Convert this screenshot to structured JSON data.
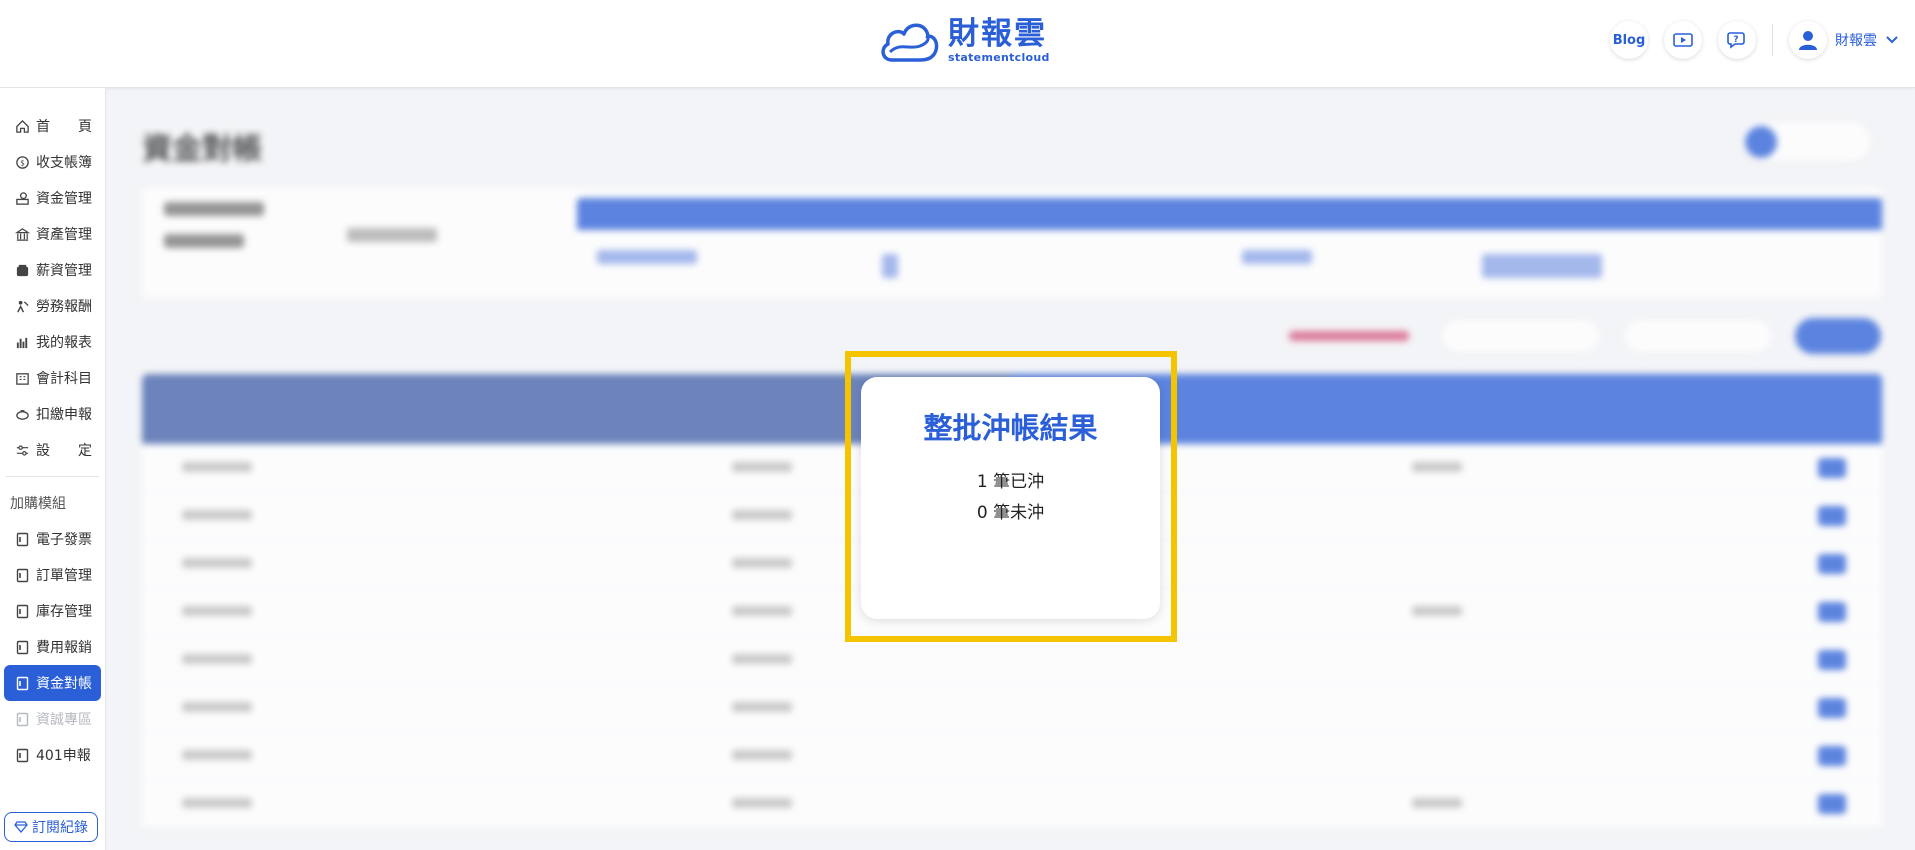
{
  "header": {
    "brand_main": "財報雲",
    "brand_sub": "statementcloud",
    "blog_label": "Blog",
    "user_name": "財報雲"
  },
  "sidebar": {
    "items": [
      {
        "label": "首　　頁",
        "icon": "home-icon"
      },
      {
        "label": "收支帳簿",
        "icon": "coin-icon"
      },
      {
        "label": "資金管理",
        "icon": "money-hand-icon"
      },
      {
        "label": "資產管理",
        "icon": "bank-icon"
      },
      {
        "label": "薪資管理",
        "icon": "wallet-icon"
      },
      {
        "label": "勞務報酬",
        "icon": "worker-icon"
      },
      {
        "label": "我的報表",
        "icon": "bar-chart-icon"
      },
      {
        "label": "會計科目",
        "icon": "building-icon"
      },
      {
        "label": "扣繳申報",
        "icon": "piggy-icon"
      },
      {
        "label": "設　　定",
        "icon": "sliders-icon"
      }
    ],
    "section_title": "加購模組",
    "modules": [
      {
        "label": "電子發票",
        "state": "normal"
      },
      {
        "label": "訂單管理",
        "state": "normal"
      },
      {
        "label": "庫存管理",
        "state": "normal"
      },
      {
        "label": "費用報銷",
        "state": "normal"
      },
      {
        "label": "資金對帳",
        "state": "active"
      },
      {
        "label": "資誠專區",
        "state": "disabled"
      },
      {
        "label": "401申報",
        "state": "normal"
      }
    ],
    "subscription_label": "訂閱紀錄"
  },
  "main": {
    "page_title": "資金對帳"
  },
  "dialog": {
    "title": "整批沖帳結果",
    "reconciled": "1 筆已沖",
    "unreconciled": "0 筆未沖"
  },
  "colors": {
    "accent": "#2a5fd8",
    "highlight": "#f5c400"
  }
}
